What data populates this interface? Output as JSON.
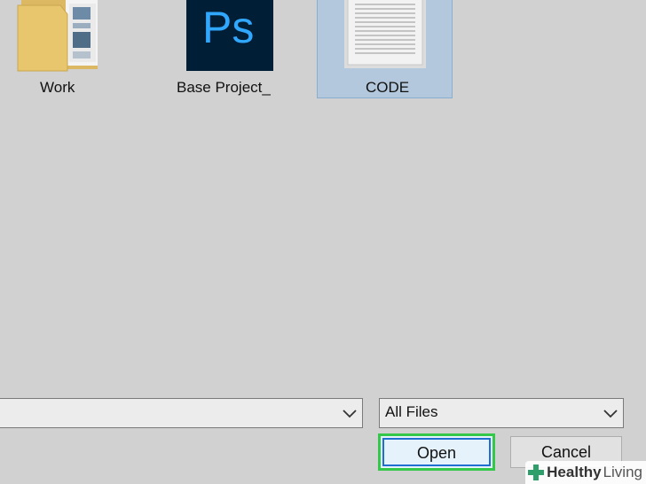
{
  "files": [
    {
      "label": "Work",
      "icon": "folder-icon"
    },
    {
      "label": "Base Project_",
      "icon": "photoshop-file-icon",
      "badge": "Ps"
    },
    {
      "label": "CODE",
      "icon": "text-document-icon",
      "selected": true
    }
  ],
  "filename_field": {
    "value": ""
  },
  "file_type_select": {
    "value": "All Files"
  },
  "buttons": {
    "open": "Open",
    "cancel": "Cancel"
  },
  "watermark": {
    "brand": "Healthy",
    "rest": " Living"
  },
  "colors": {
    "background": "#d1d1d1",
    "selection": "#b3c8dc",
    "ps_blue": "#31a8ff",
    "ps_bg": "#001e36",
    "highlight_green": "#34c84a",
    "focus_blue": "#1f6fd0"
  }
}
